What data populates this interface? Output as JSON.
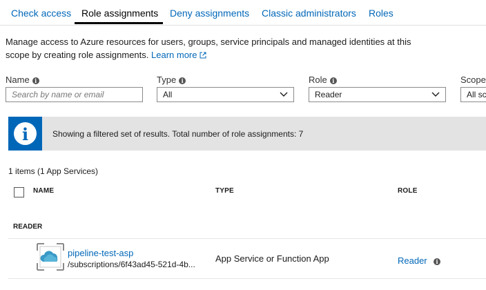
{
  "tabs": [
    {
      "label": "Check access"
    },
    {
      "label": "Role assignments"
    },
    {
      "label": "Deny assignments"
    },
    {
      "label": "Classic administrators"
    },
    {
      "label": "Roles"
    }
  ],
  "description": {
    "text": "Manage access to Azure resources for users, groups, service principals and managed identities at this scope by creating role assignments.",
    "link": "Learn more"
  },
  "filters": {
    "name": {
      "label": "Name",
      "placeholder": "Search by name or email"
    },
    "type": {
      "label": "Type",
      "value": "All"
    },
    "role": {
      "label": "Role",
      "value": "Reader"
    },
    "scope": {
      "label": "Scope",
      "value": "All sc"
    }
  },
  "banner": {
    "text": "Showing a filtered set of results. Total number of role assignments: 7"
  },
  "results": {
    "count": "1 items (1 App Services)",
    "columns": {
      "name": "NAME",
      "type": "TYPE",
      "role": "ROLE"
    },
    "group": "READER",
    "rows": [
      {
        "name": "pipeline-test-asp",
        "scope": "/subscriptions/6f43ad45-521d-4b...",
        "type": "App Service or Function App",
        "role": "Reader"
      }
    ]
  },
  "colors": {
    "accent": "#0067b8",
    "banner_bg": "#e3e3e3"
  }
}
